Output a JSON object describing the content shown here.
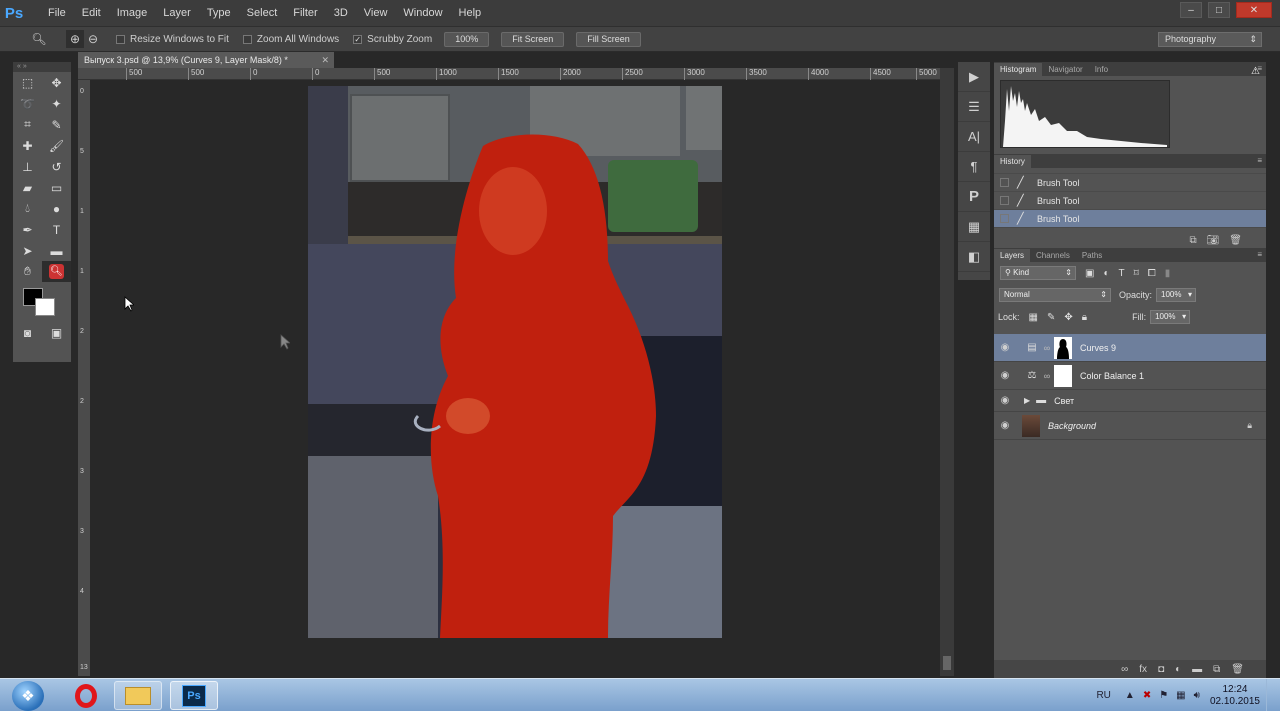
{
  "app": {
    "logo": "Ps"
  },
  "menu": [
    "File",
    "Edit",
    "Image",
    "Layer",
    "Type",
    "Select",
    "Filter",
    "3D",
    "View",
    "Window",
    "Help"
  ],
  "window_controls": {
    "minimize": "–",
    "maximize": "□",
    "close": "✕"
  },
  "options_bar": {
    "resize_windows_label": "Resize Windows to Fit",
    "zoom_all_label": "Zoom All Windows",
    "scrubby_zoom_label": "Scrubby Zoom",
    "zoom_100_label": "100%",
    "fit_screen_label": "Fit Screen",
    "fill_screen_label": "Fill Screen",
    "workspace": "Photography"
  },
  "document": {
    "tab_title": "Выпуск 3.psd @ 13,9% (Curves 9, Layer Mask/8) *",
    "ruler_top": [
      "0",
      "500",
      "1000",
      "1500",
      "2000",
      "2500",
      "3000",
      "3500",
      "4000",
      "4500",
      "5000"
    ],
    "ruler_top_left": [
      "500",
      "500",
      "0"
    ],
    "ruler_left": [
      "0",
      "5",
      "1",
      "1",
      "2",
      "2",
      "3",
      "3",
      "4",
      "13"
    ]
  },
  "panels": {
    "histogram": {
      "tabs": [
        "Histogram",
        "Navigator",
        "Info"
      ],
      "warning_icon": "⚠"
    },
    "history": {
      "tab": "History",
      "items": [
        "Brush Tool",
        "Brush Tool",
        "Brush Tool"
      ],
      "selected_index": 2
    },
    "layers": {
      "tabs": [
        "Layers",
        "Channels",
        "Paths"
      ],
      "filter_kind": "Kind",
      "blend_mode": "Normal",
      "opacity_label": "Opacity:",
      "opacity_value": "100%",
      "lock_label": "Lock:",
      "fill_label": "Fill:",
      "fill_value": "100%",
      "items": [
        {
          "name": "Curves 9",
          "selected": true
        },
        {
          "name": "Color Balance 1",
          "selected": false
        },
        {
          "name": "Свет",
          "selected": false
        },
        {
          "name": "Background",
          "selected": false
        }
      ]
    }
  },
  "taskbar": {
    "language": "RU",
    "time": "12:24",
    "date": "02.10.2015",
    "ps_label": "Ps"
  },
  "colors": {
    "accent_selected": "#6e7f9c",
    "mask_red": "#c0200e",
    "ps_blue": "#4aa8ff"
  }
}
